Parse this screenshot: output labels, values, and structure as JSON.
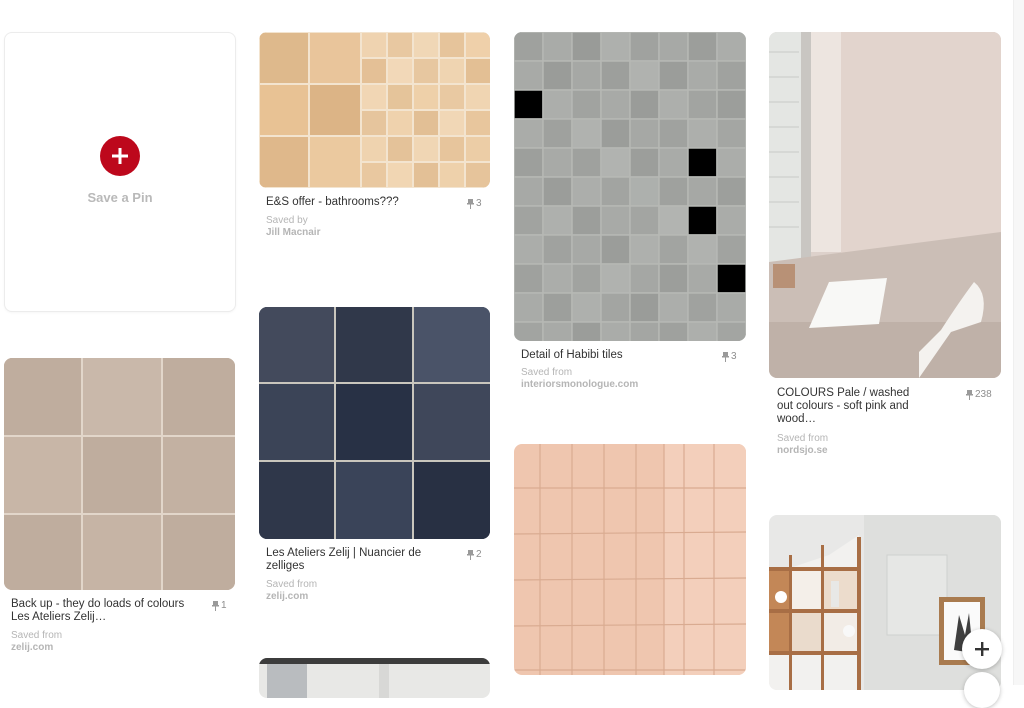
{
  "save_card": {
    "label": "Save a Pin"
  },
  "pins": [
    {
      "title": "E&S offer - bathrooms???",
      "count": "3",
      "saved_prefix": "Saved by",
      "saved_source": "Jill Macnair"
    },
    {
      "title": "Detail of Habibi tiles",
      "count": "3",
      "saved_prefix": "Saved from",
      "saved_source": "interiorsmonologue.com"
    },
    {
      "title": "COLOURS Pale / washed out colours - soft pink and wood…",
      "count": "238",
      "saved_prefix": "Saved from",
      "saved_source": "nordsjo.se"
    },
    {
      "title": "Les Ateliers Zelij | Nuancier de zelliges",
      "count": "2",
      "saved_prefix": "Saved from",
      "saved_source": "zelij.com"
    },
    {
      "title": "Back up - they do loads of colours Les Ateliers Zelij…",
      "count": "1",
      "saved_prefix": "Saved from",
      "saved_source": "zelij.com"
    }
  ],
  "icons": {
    "pin_count": "pin-icon",
    "save": "plus-icon",
    "fab": "plus-icon"
  },
  "colors": {
    "brand_red": "#bd081c",
    "text": "#333333",
    "muted": "#b5b5b5"
  }
}
